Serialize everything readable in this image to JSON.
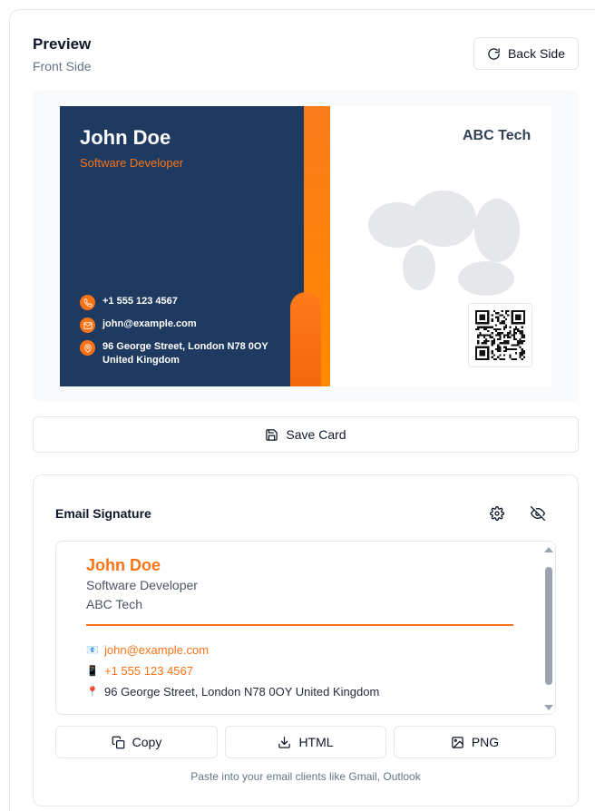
{
  "preview": {
    "title": "Preview",
    "side_label": "Front Side",
    "flip_button": "Back Side"
  },
  "card": {
    "name": "John Doe",
    "role": "Software Developer",
    "phone": "+1 555 123 4567",
    "email": "john@example.com",
    "address": "96 George Street, London N78 0OY United Kingdom",
    "company": "ABC Tech",
    "colors": {
      "primary": "#1f3a60",
      "accent": "#f97316"
    }
  },
  "save_button": "Save Card",
  "signature": {
    "title": "Email Signature",
    "name": "John Doe",
    "role": "Software Developer",
    "company": "ABC Tech",
    "email": "john@example.com",
    "phone": "+1 555 123 4567",
    "address": "96 George Street, London N78 0OY United Kingdom",
    "icons": {
      "email": "envelope-emoji",
      "phone": "phone-emoji",
      "address": "pin-emoji"
    },
    "copy_button": "Copy",
    "html_button": "HTML",
    "png_button": "PNG",
    "hint": "Paste into your email clients like Gmail, Outlook"
  }
}
